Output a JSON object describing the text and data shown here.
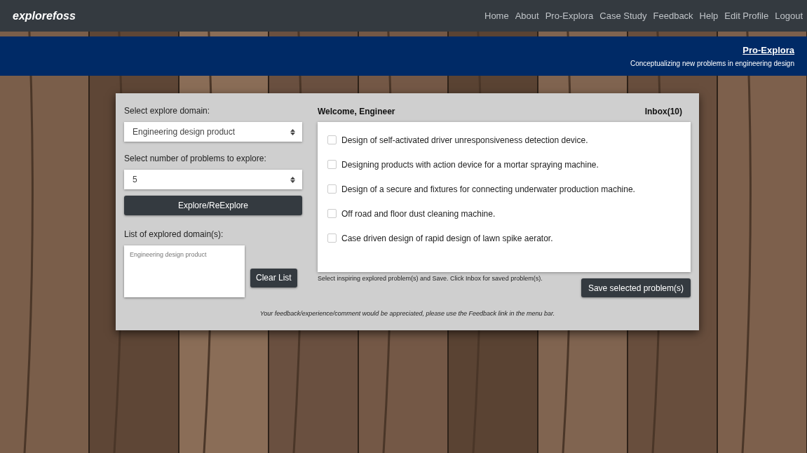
{
  "navbar": {
    "brand": "explorefoss",
    "links": [
      "Home",
      "About",
      "Pro-Explora",
      "Case Study",
      "Feedback",
      "Help",
      "Edit Profile",
      "Logout"
    ]
  },
  "banner": {
    "title": "Pro-Explora",
    "subtitle": "Conceptualizing new problems in engineering design"
  },
  "left": {
    "domain_label": "Select explore domain:",
    "domain_value": "Engineering design product",
    "count_label": "Select number of problems to explore:",
    "count_value": "5",
    "explore_button": "Explore/ReExplore",
    "list_label": "List of explored domain(s):",
    "list_value": "Engineering design product",
    "clear_button": "Clear List"
  },
  "right": {
    "welcome": "Welcome, Engineer",
    "inbox": "Inbox(10)",
    "problems": [
      {
        "text": "Design of self-activated driver unresponsiveness detection device.",
        "checked": false
      },
      {
        "text": "Designing products with action device for a mortar spraying machine.",
        "checked": false
      },
      {
        "text": "Design of a secure and fixtures for connecting underwater production machine.",
        "checked": false
      },
      {
        "text": "Off road and floor dust cleaning machine.",
        "checked": false
      },
      {
        "text": "Case driven design of rapid design of lawn spike aerator.",
        "checked": false
      }
    ],
    "hint": "Select inspiring explored problem(s) and Save. Click Inbox for saved problem(s).",
    "save_button": "Save selected problem(s)"
  },
  "footer_note": "Your feedback/experience/comment would be appreciated, please use the Feedback link in the menu bar."
}
